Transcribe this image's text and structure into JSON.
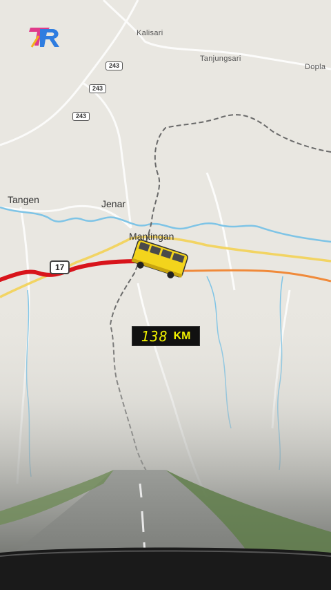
{
  "map": {
    "places": [
      {
        "key": "kalisari",
        "name": "Kalisari"
      },
      {
        "key": "tanjungsari",
        "name": "Tanjungsari"
      },
      {
        "key": "dopla",
        "name": "Dopla"
      },
      {
        "key": "tangen",
        "name": "Tangen"
      },
      {
        "key": "jenar",
        "name": "Jenar"
      },
      {
        "key": "mantingan",
        "name": "Mantingan"
      }
    ],
    "road_shields": [
      "243",
      "243",
      "243",
      "17"
    ]
  },
  "overlay": {
    "speed_value": "138",
    "speed_unit": "KM"
  },
  "colors": {
    "route_done": "#d8141b",
    "route_ahead": "#f08a3a",
    "highway": "#f2d463",
    "river": "#7ec4e6",
    "border": "#6a6a6a",
    "bus_body": "#f3d41c",
    "speed_digits": "#f0f000"
  },
  "icons": {
    "vehicle": "yellow-bus-icon",
    "logo": "channel-logo-icon"
  }
}
